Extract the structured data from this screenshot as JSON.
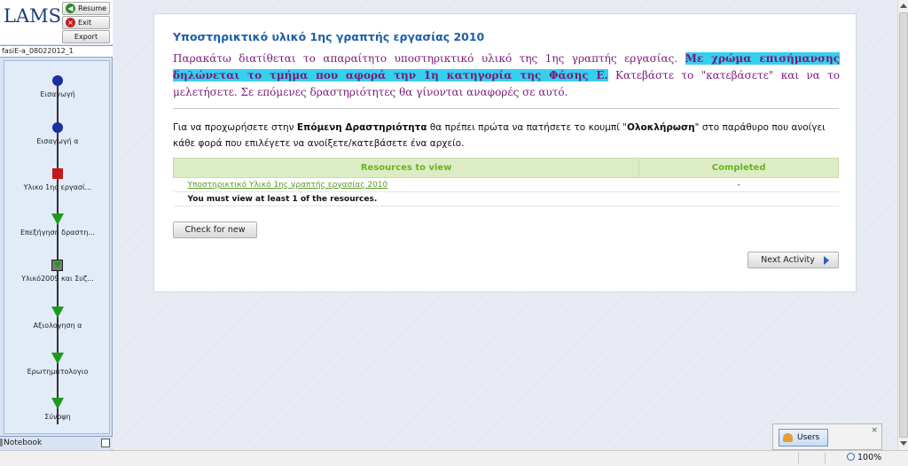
{
  "app": {
    "logo": "LAMS",
    "buttons": {
      "resume": "Resume",
      "exit": "Exit",
      "export": "Export"
    }
  },
  "sidebar": {
    "sequence_name": "fasiE-a_08022012_1",
    "activities": [
      {
        "label": "Εισαγωγή",
        "state": "completed"
      },
      {
        "label": "Εισαγωγή α",
        "state": "completed"
      },
      {
        "label": "Υλικο 1ης εργασί...",
        "state": "current"
      },
      {
        "label": "Επεξήγηση δραστη...",
        "state": "not-attempted"
      },
      {
        "label": "Υλικό2009 και Συζ...",
        "state": "optional"
      },
      {
        "label": "Αξιολογηση α",
        "state": "not-attempted"
      },
      {
        "label": "Ερωτηματολογιο",
        "state": "not-attempted"
      },
      {
        "label": "Σύνοψη",
        "state": "not-attempted"
      }
    ],
    "notebook_label": "Notebook"
  },
  "main": {
    "title": "Υποστηρικτικό υλικό 1ης γραπτής εργασίας 2010",
    "instructions": {
      "part1": "Παρακάτω διατίθεται το απαραίτητο υποστηρικτικό υλικό της 1ης γραπτής εργασίας. ",
      "highlight": "Με χρώμα επισήμανσης δηλώνεται το τμήμα που αφορά την 1η κατηγορία της Φάσης Ε.",
      "part2": " Κατεβάστε το \"κατεβάσετε\" και να το μελετήσετε. Σε επόμενες δραστηριότητες θα γίνονται αναφορές σε αυτό."
    },
    "note": {
      "pre": "Για να προχωρήσετε στην ",
      "bold1": "Επόμενη Δραστηριότητα",
      "mid": " θα πρέπει πρώτα να πατήσετε το κουμπί \"",
      "bold2": "Ολοκλήρωση",
      "post": "\" στο παράθυρο που ανοίγει κάθε φορά που επιλέγετε να ανοίξετε/κατεβάσετε ένα αρχείο."
    },
    "table": {
      "headers": {
        "resource": "Resources to view",
        "completed": "Completed"
      },
      "rows": [
        {
          "resource": "Υποστηρικτικό Υλικό 1ης γραπτής εργασίας 2010",
          "completed": "-"
        }
      ],
      "requirement": "You must view at least 1 of the resources."
    },
    "check_button": "Check for new",
    "next_button": "Next Activity"
  },
  "users_widget": {
    "label": "Users",
    "close": "×"
  },
  "statusbar": {
    "zoom": "100%"
  },
  "colors": {
    "title": "#1f5fa8",
    "instructions": "#7a1a78",
    "highlight": "#35d0f0",
    "table_header_bg": "#dcedc5",
    "table_header_text": "#6ab320"
  }
}
